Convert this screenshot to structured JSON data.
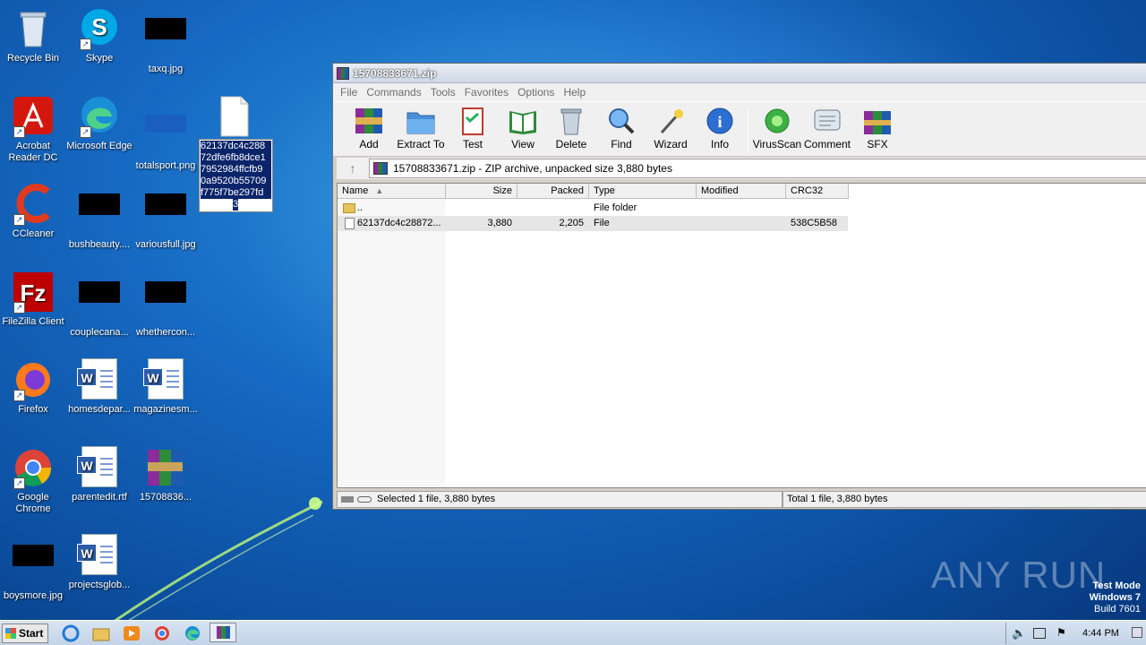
{
  "desktop": {
    "icons": [
      {
        "label": "Recycle Bin"
      },
      {
        "label": "Skype"
      },
      {
        "label": "taxq.jpg"
      },
      {
        "label": "Acrobat Reader DC"
      },
      {
        "label": "Microsoft Edge"
      },
      {
        "label": "totalsport.png"
      },
      {
        "label": ""
      },
      {
        "label": "CCleaner"
      },
      {
        "label": "bushbeauty...."
      },
      {
        "label": "variousfull.jpg"
      },
      {
        "label": "FileZilla Client"
      },
      {
        "label": "couplecana..."
      },
      {
        "label": "whethercon..."
      },
      {
        "label": "Firefox"
      },
      {
        "label": "homesdepar..."
      },
      {
        "label": "magazinesm..."
      },
      {
        "label": "Google Chrome"
      },
      {
        "label": "parentedit.rtf"
      },
      {
        "label": "15708836..."
      },
      {
        "label": "boysmore.jpg"
      },
      {
        "label": "projectsglob..."
      }
    ],
    "tooltip_lines": [
      "62137dc4c288",
      "72dfe6fb8dce1",
      "7952984ffcfb9",
      "0a9520b55709",
      "f775f7be297fd",
      "3"
    ]
  },
  "window": {
    "title": "15708833671.zip",
    "menu": [
      "File",
      "Commands",
      "Tools",
      "Favorites",
      "Options",
      "Help"
    ],
    "toolbar": [
      "Add",
      "Extract To",
      "Test",
      "View",
      "Delete",
      "Find",
      "Wizard",
      "Info",
      "VirusScan",
      "Comment",
      "SFX"
    ],
    "address": "15708833671.zip - ZIP archive, unpacked size 3,880 bytes",
    "columns": [
      "Name",
      "Size",
      "Packed",
      "Type",
      "Modified",
      "CRC32"
    ],
    "rows": [
      {
        "name": "..",
        "size": "",
        "packed": "",
        "type": "File folder",
        "modified": "",
        "crc": ""
      },
      {
        "name": "62137dc4c28872...",
        "size": "3,880",
        "packed": "2,205",
        "type": "File",
        "modified": "",
        "crc": "538C5B58"
      }
    ],
    "status_left": "Selected 1 file, 3,880 bytes",
    "status_right": "Total 1 file, 3,880 bytes"
  },
  "taskbar": {
    "start": "Start",
    "clock": "4:44 PM"
  },
  "watermark": "ANY RUN",
  "testmode": [
    "Test Mode",
    "Windows 7",
    "Build 7601"
  ]
}
